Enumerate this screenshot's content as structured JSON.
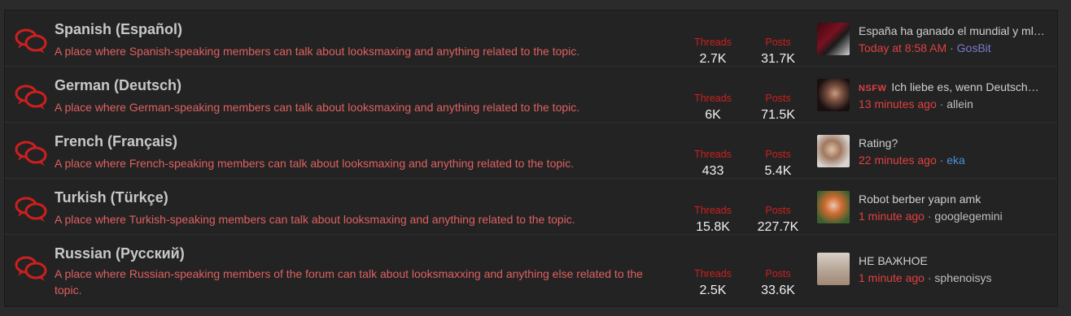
{
  "forums": [
    {
      "title": "Spanish (Español)",
      "description": "A place where Spanish-speaking members can talk about looksmaxing and anything related to the topic.",
      "threads_label": "Threads",
      "threads": "2.7K",
      "posts_label": "Posts",
      "posts": "31.7K",
      "latest_title": "España ha ganado el mundial y ml…",
      "latest_prefix": "",
      "latest_time": "Today at 8:58 AM",
      "latest_user": "GosBit"
    },
    {
      "title": "German (Deutsch)",
      "description": "A place where German-speaking members can talk about looksmaxing and anything related to the topic.",
      "threads_label": "Threads",
      "threads": "6K",
      "posts_label": "Posts",
      "posts": "71.5K",
      "latest_title": "Ich liebe es, wenn Deutsch…",
      "latest_prefix": "NSFW",
      "latest_time": "13 minutes ago",
      "latest_user": "allein"
    },
    {
      "title": "French (Français)",
      "description": "A place where French-speaking members can talk about looksmaxing and anything related to the topic.",
      "threads_label": "Threads",
      "threads": "433",
      "posts_label": "Posts",
      "posts": "5.4K",
      "latest_title": "Rating?",
      "latest_prefix": "",
      "latest_time": "22 minutes ago",
      "latest_user": "eka"
    },
    {
      "title": "Turkish (Türkçe)",
      "description": "A place where Turkish-speaking members can talk about looksmaxing and anything related to the topic.",
      "threads_label": "Threads",
      "threads": "15.8K",
      "posts_label": "Posts",
      "posts": "227.7K",
      "latest_title": "Robot berber yapın amk",
      "latest_prefix": "",
      "latest_time": "1 minute ago",
      "latest_user": "googlegemini"
    },
    {
      "title": "Russian (Русский)",
      "description": "A place where Russian-speaking members of the forum can talk about looksmaxxing and anything else related to the topic.",
      "threads_label": "Threads",
      "threads": "2.5K",
      "posts_label": "Posts",
      "posts": "33.6K",
      "latest_title": "НЕ ВАЖНОЕ",
      "latest_prefix": "",
      "latest_time": "1 minute ago",
      "latest_user": "sphenoisys"
    }
  ],
  "separator": "·",
  "colors": {
    "accent_red": "#cc2020",
    "description_red": "#e06060",
    "user_blue": "#4a8fd6",
    "user_purple": "#7a7ad0"
  },
  "icons": {
    "forum_icon": "chat-bubbles-icon"
  }
}
